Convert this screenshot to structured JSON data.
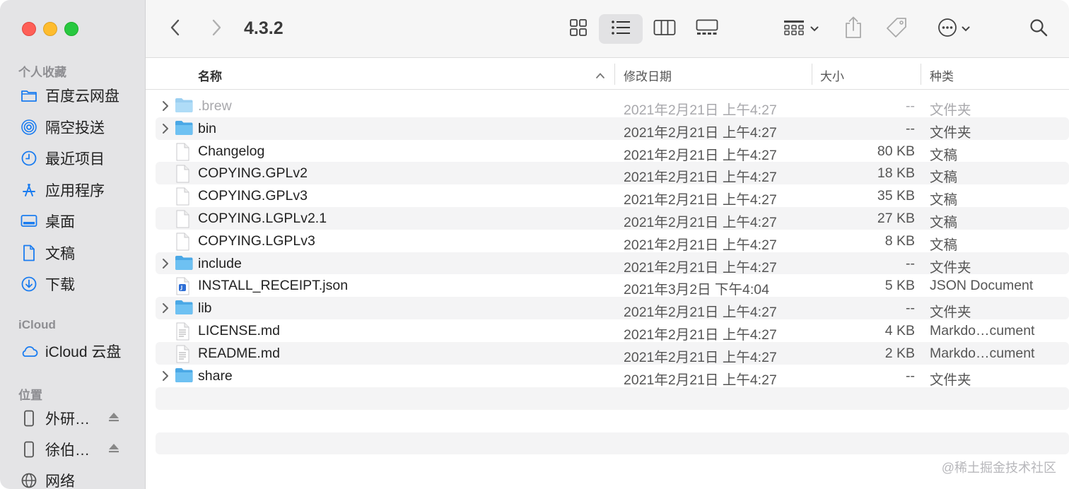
{
  "window": {
    "title": "4.3.2"
  },
  "sidebar": {
    "sections": [
      {
        "label": "个人收藏",
        "items": [
          {
            "label": "百度云网盘",
            "icon": "folder-icon"
          },
          {
            "label": "隔空投送",
            "icon": "airdrop-icon"
          },
          {
            "label": "最近项目",
            "icon": "clock-icon"
          },
          {
            "label": "应用程序",
            "icon": "applications-icon"
          },
          {
            "label": "桌面",
            "icon": "desktop-icon"
          },
          {
            "label": "文稿",
            "icon": "document-icon"
          },
          {
            "label": "下载",
            "icon": "download-icon"
          }
        ]
      },
      {
        "label": "iCloud",
        "items": [
          {
            "label": "iCloud 云盘",
            "icon": "cloud-icon"
          }
        ]
      },
      {
        "label": "位置",
        "items": [
          {
            "label": "外研…",
            "icon": "phone-icon"
          },
          {
            "label": "徐伯…",
            "icon": "phone-icon"
          },
          {
            "label": "网络",
            "icon": "globe-icon"
          }
        ]
      }
    ]
  },
  "columns": {
    "name": "名称",
    "date": "修改日期",
    "size": "大小",
    "kind": "种类"
  },
  "files": [
    {
      "name": ".brew",
      "date": "2021年2月21日 上午4:27",
      "size": "--",
      "kind": "文件夹",
      "type": "folder",
      "dim": true
    },
    {
      "name": "bin",
      "date": "2021年2月21日 上午4:27",
      "size": "--",
      "kind": "文件夹",
      "type": "folder"
    },
    {
      "name": "Changelog",
      "date": "2021年2月21日 上午4:27",
      "size": "80 KB",
      "kind": "文稿",
      "type": "doc"
    },
    {
      "name": "COPYING.GPLv2",
      "date": "2021年2月21日 上午4:27",
      "size": "18 KB",
      "kind": "文稿",
      "type": "doc"
    },
    {
      "name": "COPYING.GPLv3",
      "date": "2021年2月21日 上午4:27",
      "size": "35 KB",
      "kind": "文稿",
      "type": "doc"
    },
    {
      "name": "COPYING.LGPLv2.1",
      "date": "2021年2月21日 上午4:27",
      "size": "27 KB",
      "kind": "文稿",
      "type": "doc"
    },
    {
      "name": "COPYING.LGPLv3",
      "date": "2021年2月21日 上午4:27",
      "size": "8 KB",
      "kind": "文稿",
      "type": "doc"
    },
    {
      "name": "include",
      "date": "2021年2月21日 上午4:27",
      "size": "--",
      "kind": "文件夹",
      "type": "folder"
    },
    {
      "name": "INSTALL_RECEIPT.json",
      "date": "2021年3月2日 下午4:04",
      "size": "5 KB",
      "kind": "JSON Document",
      "type": "json"
    },
    {
      "name": "lib",
      "date": "2021年2月21日 上午4:27",
      "size": "--",
      "kind": "文件夹",
      "type": "folder"
    },
    {
      "name": "LICENSE.md",
      "date": "2021年2月21日 上午4:27",
      "size": "4 KB",
      "kind": "Markdo…cument",
      "type": "md"
    },
    {
      "name": "README.md",
      "date": "2021年2月21日 上午4:27",
      "size": "2 KB",
      "kind": "Markdo…cument",
      "type": "md"
    },
    {
      "name": "share",
      "date": "2021年2月21日 上午4:27",
      "size": "--",
      "kind": "文件夹",
      "type": "folder"
    }
  ],
  "watermark": "@稀土掘金技术社区",
  "colors": {
    "folder": "#5db3ea",
    "accent": "#1a7cf0",
    "sidebar_bg": "#e4e4e6"
  }
}
